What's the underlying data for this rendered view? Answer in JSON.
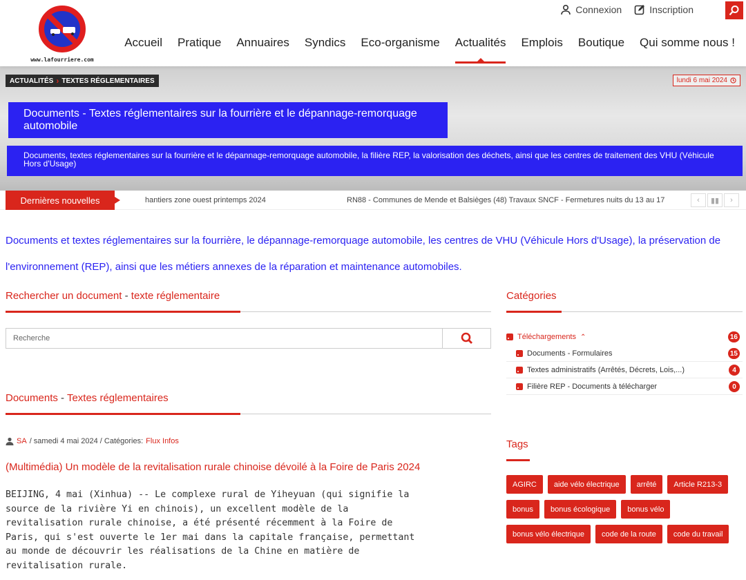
{
  "header": {
    "logo_caption": "www.lafourriere.com",
    "login_label": "Connexion",
    "signup_label": "Inscription",
    "nav": [
      {
        "label": "Accueil",
        "active": false
      },
      {
        "label": "Pratique",
        "active": false
      },
      {
        "label": "Annuaires",
        "active": false
      },
      {
        "label": "Syndics",
        "active": false
      },
      {
        "label": "Eco-organisme",
        "active": false
      },
      {
        "label": "Actualités",
        "active": true
      },
      {
        "label": "Emplois",
        "active": false
      },
      {
        "label": "Boutique",
        "active": false
      },
      {
        "label": "Qui somme nous !",
        "active": false
      }
    ]
  },
  "banner": {
    "breadcrumb": [
      "ACTUALITÉS",
      "TEXTES RÉGLEMENTAIRES"
    ],
    "date": "lundi 6 mai 2024",
    "title": "Documents - Textes réglementaires sur la fourrière et le dépannage-remorquage automobile",
    "description": "Documents, textes réglementaires sur la fourrière et le dépannage-remorquage automobile, la filière REP, la valorisation des déchets, ainsi que les centres de traitement des VHU (Véhicule Hors d'Usage)"
  },
  "ticker": {
    "label": "Dernières nouvelles",
    "items": [
      "hantiers zone ouest printemps 2024",
      "RN88 - Communes de Mende et Balsièges (48) Travaux SNCF - Fermetures nuits du 13 au 17"
    ]
  },
  "intro": "Documents et textes réglementaires sur la fourrière, le dépannage-remorquage automobile, les centres de VHU (Véhicule Hors d'Usage), la préservation de l'environnement (REP), ainsi que les métiers annexes de la réparation et maintenance automobiles.",
  "search": {
    "heading_a": "Rechercher un document",
    "heading_sep": " - ",
    "heading_b": "texte réglementaire",
    "placeholder": "Recherche"
  },
  "documents": {
    "heading_a": "Documents",
    "heading_sep": " - ",
    "heading_b": "Textes réglementaires"
  },
  "article": {
    "author": "SA",
    "date": "/ samedi 4 mai 2024 / Catégories:",
    "category": "Flux Infos",
    "title": "(Multimédia) Un modèle de la revitalisation rurale chinoise dévoilé à la Foire de Paris 2024",
    "body_lines": [
      "BEIJING, 4 mai (Xinhua) -- Le complexe rural de Yiheyuan (qui signifie la",
      "source de la rivière Yi en chinois), un excellent modèle de la",
      "revitalisation rurale chinoise, a été présenté récemment à la Foire de",
      "Paris, qui s'est ouverte le 1er mai dans la capitale française, permettant",
      "au monde de découvrir les réalisations de la Chine en matière de",
      "revitalisation rurale."
    ]
  },
  "categories": {
    "heading": "Catégories",
    "items": [
      {
        "label": "Téléchargements",
        "count": "16",
        "level": "main"
      },
      {
        "label": "Documents - Formulaires",
        "count": "15",
        "level": "sub"
      },
      {
        "label": "Textes administratifs (Arrêtés, Décrets, Lois,...)",
        "count": "4",
        "level": "sub"
      },
      {
        "label": "Filière REP - Documents à télécharger",
        "count": "0",
        "level": "sub"
      }
    ]
  },
  "tags": {
    "heading": "Tags",
    "items": [
      "AGIRC",
      "aide vélo électrique",
      "arrêté",
      "Article R213-3",
      "bonus",
      "bonus écologique",
      "bonus vélo",
      "bonus vélo électrique",
      "code de la route",
      "code du travail"
    ]
  },
  "colors": {
    "accent": "#d9261c",
    "banner_blue": "#2b22f2"
  },
  "icons": [
    "user-icon",
    "edit-icon",
    "search-icon",
    "clock-icon",
    "rss-icon",
    "chevron-up-icon",
    "chevron-left-icon",
    "pause-icon",
    "chevron-right-icon"
  ]
}
